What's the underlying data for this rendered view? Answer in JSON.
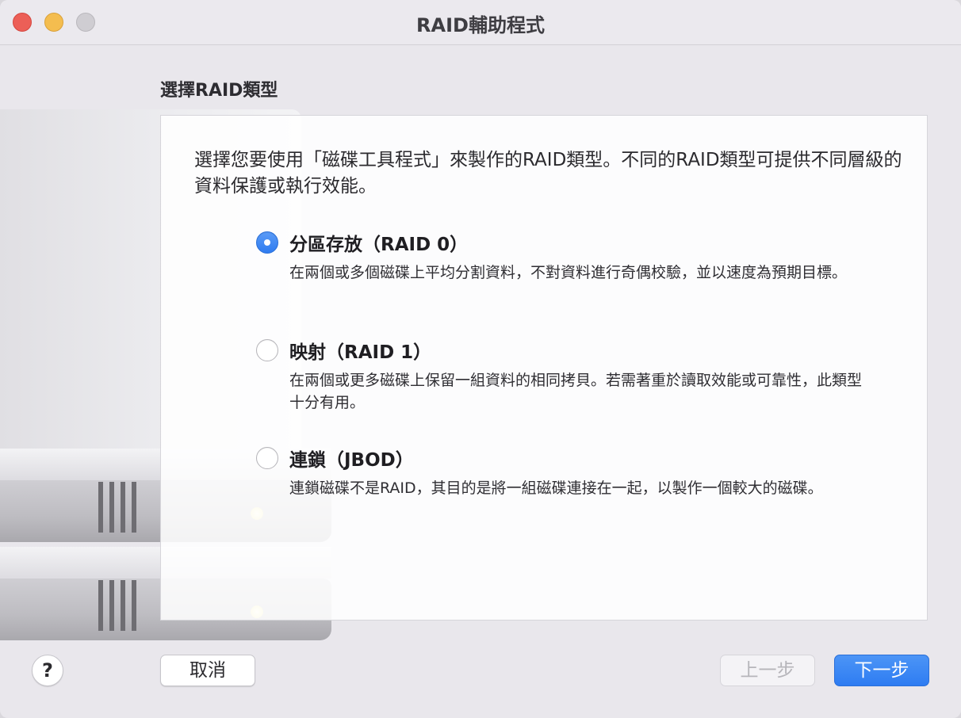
{
  "window": {
    "title": "RAID輔助程式"
  },
  "page": {
    "heading": "選擇RAID類型",
    "intro": "選擇您要使用「磁碟工具程式」來製作的RAID類型。不同的RAID類型可提供不同層級的資料保護或執行效能。"
  },
  "options": [
    {
      "title": "分區存放（RAID 0）",
      "description": "在兩個或多個磁碟上平均分割資料，不對資料進行奇偶校驗，並以速度為預期目標。",
      "selected": true
    },
    {
      "title": "映射（RAID 1）",
      "description": "在兩個或更多磁碟上保留一組資料的相同拷貝。若需著重於讀取效能或可靠性，此類型十分有用。",
      "selected": false
    },
    {
      "title": "連鎖（JBOD）",
      "description": "連鎖磁碟不是RAID，其目的是將一組磁碟連接在一起，以製作一個較大的磁碟。",
      "selected": false
    }
  ],
  "buttons": {
    "help": "?",
    "cancel": "取消",
    "back": "上一步",
    "next": "下一步"
  },
  "colors": {
    "accent": "#2f7cf0",
    "close": "#ec5f57",
    "minimize": "#f4bd4f",
    "zoom_disabled": "#cfcdd2"
  }
}
